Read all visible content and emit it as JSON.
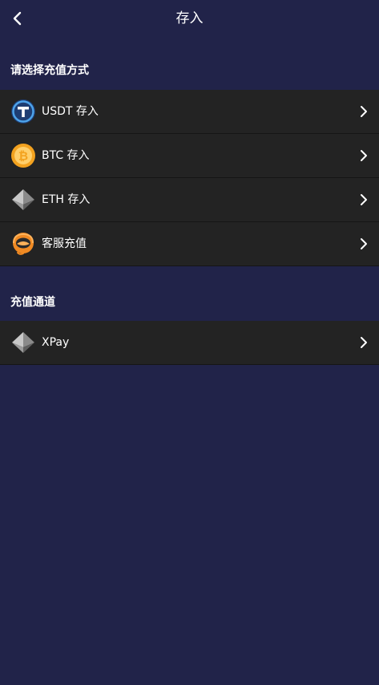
{
  "header": {
    "title": "存入"
  },
  "section_deposit": {
    "title": "请选择充值方式",
    "items": [
      {
        "label": "USDT 存入",
        "icon": "usdt-icon"
      },
      {
        "label": "BTC 存入",
        "icon": "btc-icon"
      },
      {
        "label": "ETH 存入",
        "icon": "eth-icon"
      },
      {
        "label": "客服充值",
        "icon": "customer-service-icon"
      }
    ]
  },
  "section_channel": {
    "title": "充值通道",
    "items": [
      {
        "label": "XPay",
        "icon": "xpay-icon"
      }
    ]
  },
  "colors": {
    "background": "#212349",
    "row_background": "#232323",
    "usdt_blue": "#3c8fd8",
    "btc_orange": "#f3a21f",
    "cs_orange": "#f08a23"
  }
}
